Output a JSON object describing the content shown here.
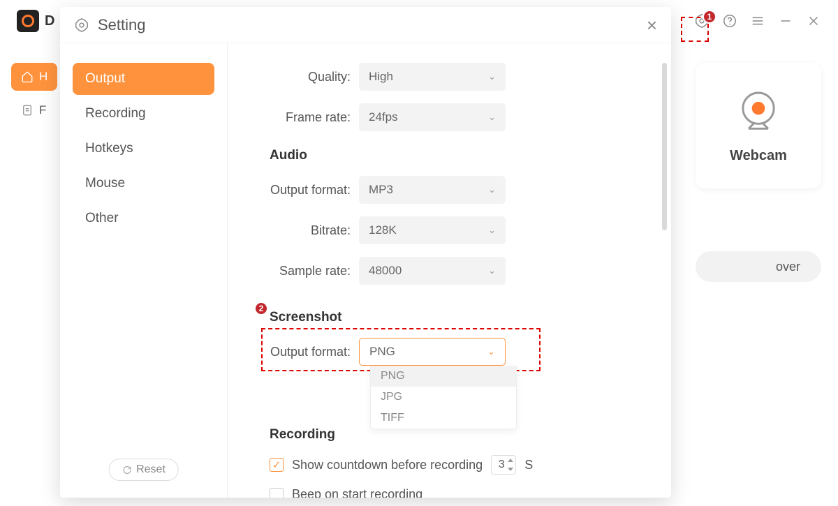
{
  "bg": {
    "logo_letter": "D",
    "side_home": "H",
    "side_files": "F",
    "webcam_label": "Webcam",
    "over_label": "over"
  },
  "modal": {
    "title": "Setting",
    "nav": {
      "output": "Output",
      "recording": "Recording",
      "hotkeys": "Hotkeys",
      "mouse": "Mouse",
      "other": "Other"
    },
    "reset": "Reset"
  },
  "video": {
    "quality_label": "Quality:",
    "quality_value": "High",
    "framerate_label": "Frame rate:",
    "framerate_value": "24fps"
  },
  "audio": {
    "heading": "Audio",
    "format_label": "Output format:",
    "format_value": "MP3",
    "bitrate_label": "Bitrate:",
    "bitrate_value": "128K",
    "samplerate_label": "Sample rate:",
    "samplerate_value": "48000"
  },
  "screenshot": {
    "heading": "Screenshot",
    "format_label": "Output format:",
    "format_value": "PNG",
    "options": [
      "PNG",
      "JPG",
      "TIFF"
    ]
  },
  "recording": {
    "heading": "Recording",
    "countdown_label": "Show countdown before recording",
    "countdown_value": "3",
    "countdown_unit": "S",
    "beep_label": "Beep on start recording"
  },
  "anno": {
    "one": "1",
    "two": "2"
  }
}
